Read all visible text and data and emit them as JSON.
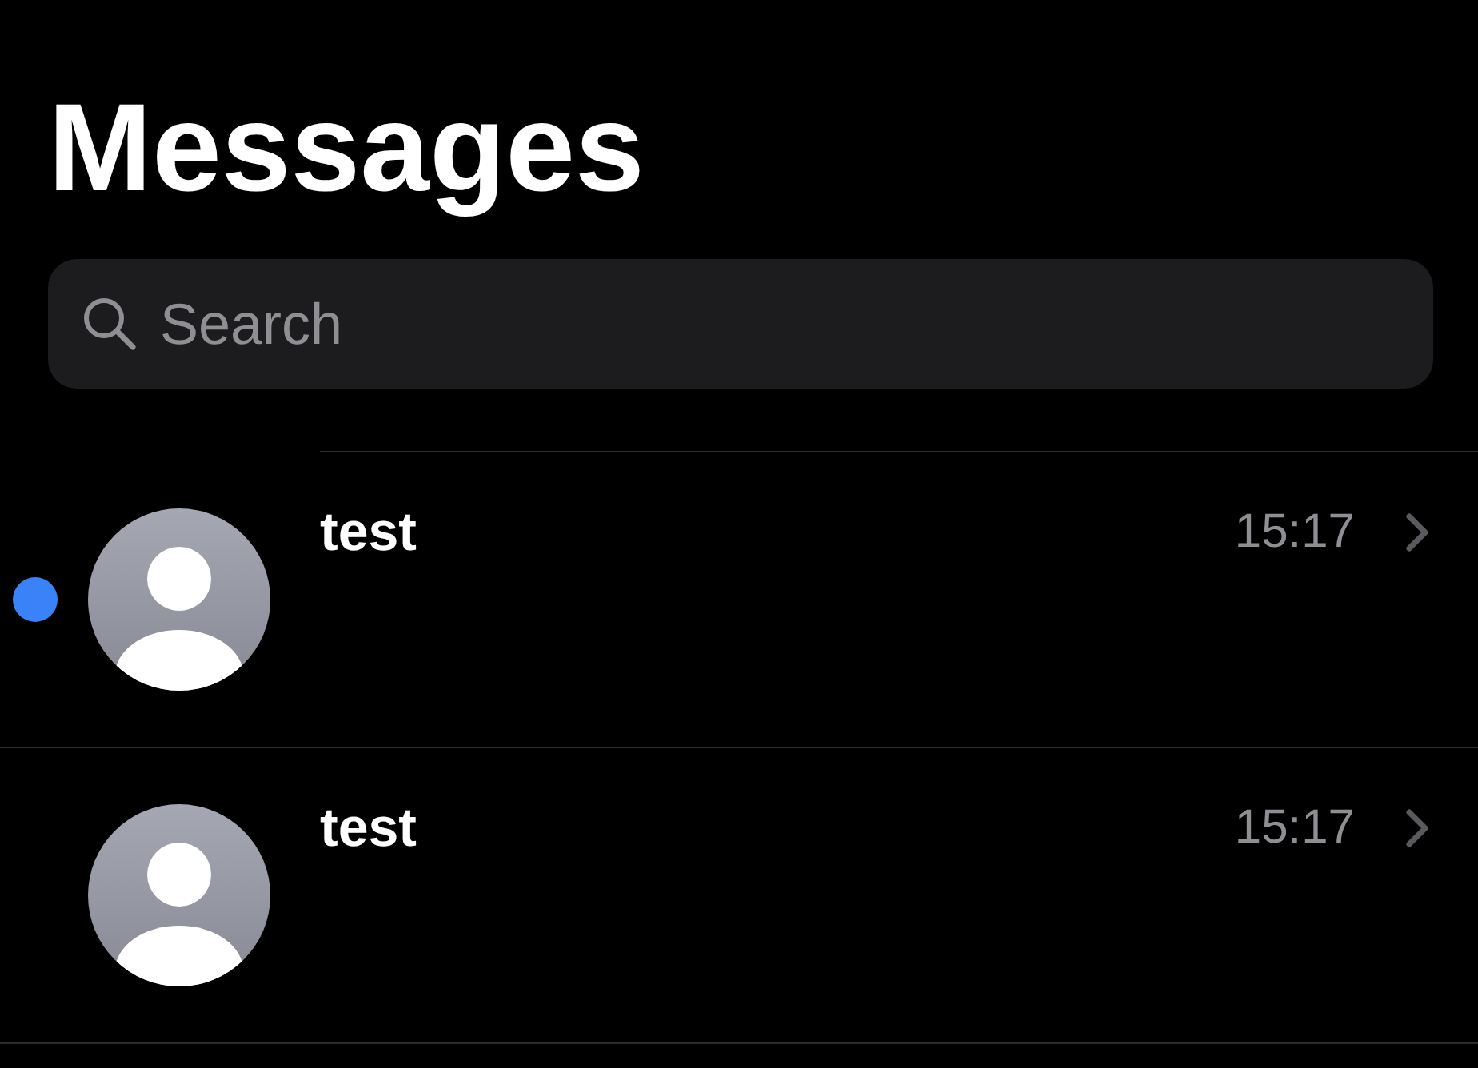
{
  "title": "Messages",
  "search": {
    "placeholder": "Search"
  },
  "conversations": [
    {
      "name": "test",
      "time": "15:17",
      "unread": true
    },
    {
      "name": "test",
      "time": "15:17",
      "unread": false
    }
  ]
}
